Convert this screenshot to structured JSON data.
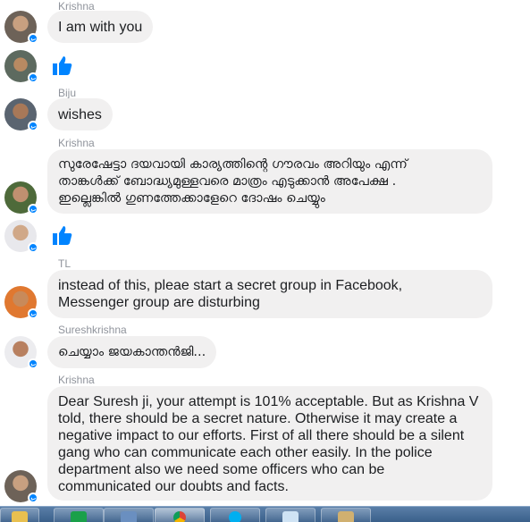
{
  "messages": [
    {
      "sender": "Krishna",
      "text": "I am with you"
    },
    {
      "sender": "Biju",
      "text": "wishes"
    },
    {
      "sender": "Krishna",
      "lines": [
        "സുരേഷേട്ടാ ദയവായി കാര്യത്തിന്റെ ഗൗരവം അറിയും എന്ന്",
        "താങ്കൾക്ക് ബോദ്ധ്യമുള്ളവരെ മാത്രം എടുക്കാൻ അപേക്ഷ .",
        "ഇല്ലെങ്കിൽ ഗുണത്തേക്കാളേറെ ദോഷം ചെയ്യും"
      ]
    },
    {
      "sender": "TL",
      "lines": [
        "instead of this, pleae start a secret group in Facebook,",
        "Messenger group are disturbing"
      ]
    },
    {
      "sender": "Sureshkrishna",
      "text": "ചെയ്യാം ജയകാന്തൻജി..."
    },
    {
      "sender": "Krishna",
      "lines": [
        "Dear Suresh ji, your attempt is 101% acceptable.  But as Krishna V",
        "told, there should be a secret nature.  Otherwise it may create a",
        "negative impact to our efforts. First of all there should be a silent",
        "gang who can communicate each other easily.  In the police",
        "department also we need some officers who can be",
        "communicated our doubts and facts."
      ]
    }
  ],
  "colors": {
    "bubble": "#f1f0f0",
    "sender": "#90949c",
    "like": "#0084ff",
    "badge": "#0084ff",
    "taskbar": "#4a6f98"
  },
  "taskbar": {
    "items": [
      "folder-icon",
      "store-icon",
      "media-icon",
      "chrome-icon",
      "skype-icon",
      "notepad-icon",
      "paint-icon"
    ]
  }
}
